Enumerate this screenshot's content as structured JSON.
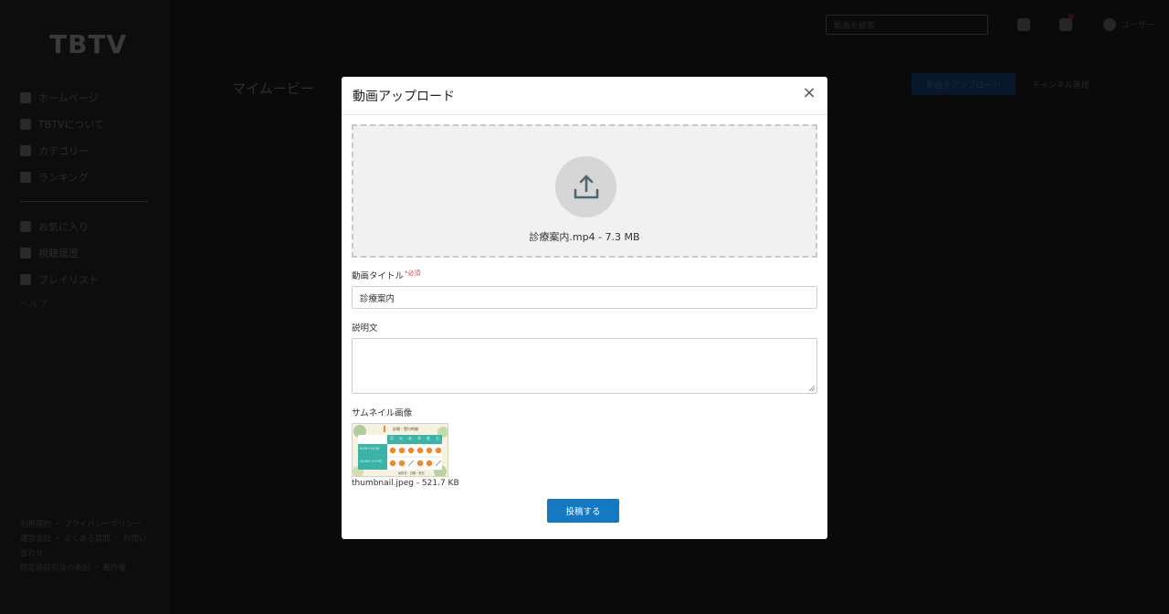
{
  "app": {
    "logo": "TBTV",
    "nav": [
      {
        "label": "ホームページ",
        "icon": "home-icon"
      },
      {
        "label": "TBTVについて",
        "icon": "info-icon"
      },
      {
        "label": "カテゴリー",
        "icon": "category-icon"
      },
      {
        "label": "ランキング",
        "icon": "ranking-icon"
      }
    ],
    "nav2": [
      {
        "label": "お気に入り",
        "icon": "heart-icon"
      },
      {
        "label": "視聴履歴",
        "icon": "history-icon"
      },
      {
        "label": "プレイリスト",
        "icon": "list-icon"
      }
    ],
    "nav_extra": "ヘルプ",
    "footer_links": [
      "利用規約 ・ プライバシーポリシー",
      "運営会社 ・ よくある質問 ・ お問い合わせ",
      "特定商取引法の表記 ・ 著作権"
    ],
    "search_placeholder": "動画を検索",
    "user_label": "ユーザー",
    "page_title": "マイムービー",
    "upload_button": "動画をアップロード",
    "manage_link": "チャンネル管理"
  },
  "modal": {
    "title": "動画アップロード",
    "close": "×",
    "file_label": "診療案内.mp4 - 7.3 MB",
    "title_label": "動画タイトル",
    "required": "*必須",
    "title_value": "診療案内",
    "description_label": "説明文",
    "description_value": "",
    "thumbnail_label": "サムネイル画像",
    "thumbnail_file": "thumbnail.jpeg - 521.7 KB",
    "submit": "投稿する"
  },
  "thumbnail": {
    "heading": "診療・受付時間",
    "days": [
      "月",
      "火",
      "水",
      "木",
      "金",
      "土"
    ],
    "row1": "9:00〜12:30",
    "row2": "14:00〜17:30",
    "note": "休診日：日曜・祝日"
  },
  "colors": {
    "accent": "#1478c2",
    "required": "#e04545",
    "thumb_teal": "#3bb3a6",
    "thumb_orange": "#f08a24"
  }
}
